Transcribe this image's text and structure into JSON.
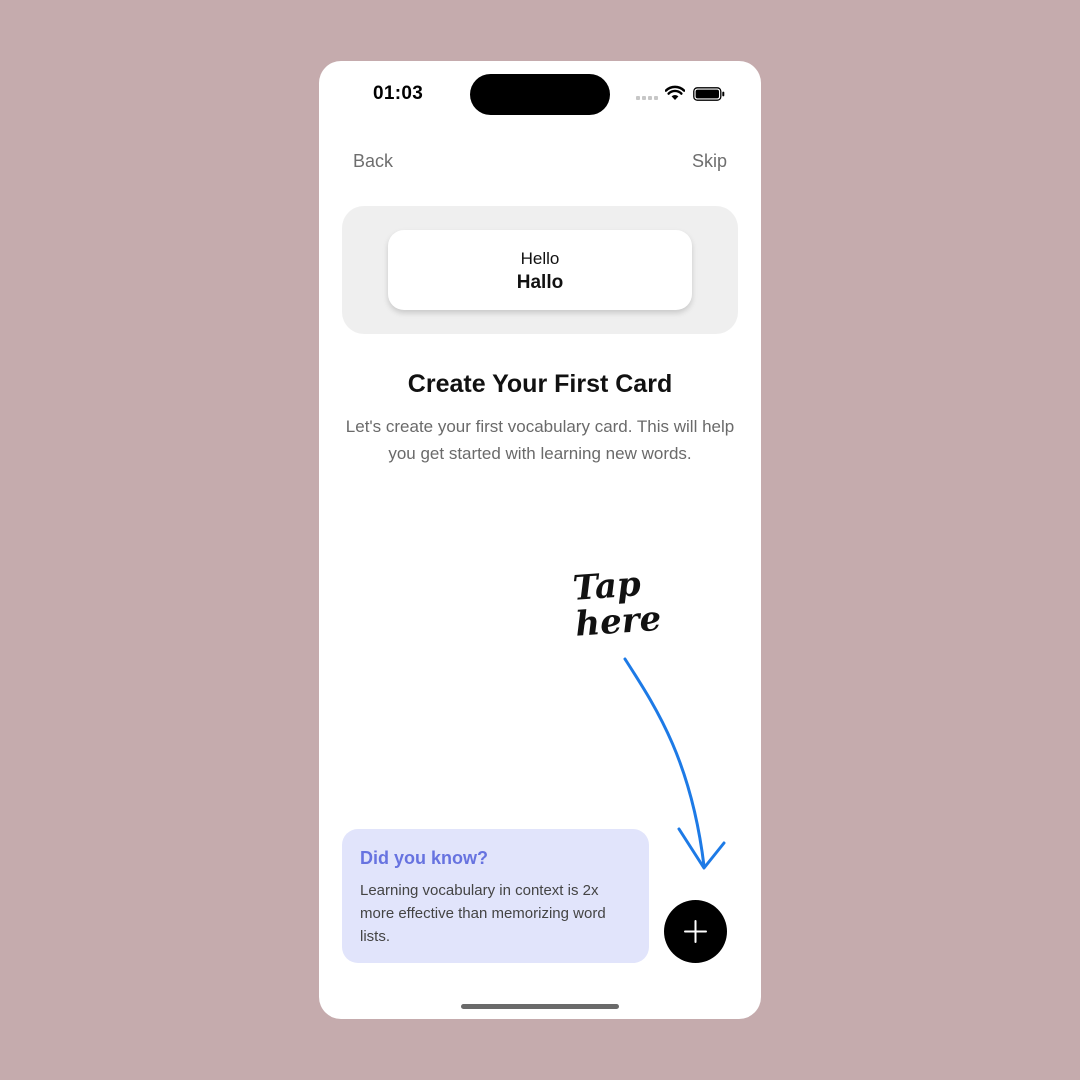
{
  "status_bar": {
    "time": "01:03"
  },
  "nav": {
    "back_label": "Back",
    "skip_label": "Skip"
  },
  "preview_card": {
    "front": "Hello",
    "back": "Hallo"
  },
  "onboarding": {
    "title": "Create Your First Card",
    "subtitle": "Let's create your first vocabulary card. This will help you get started with learning new words."
  },
  "annotation": {
    "hint_line1": "Tap",
    "hint_line2": "here",
    "arrow_color": "#1d7ae6"
  },
  "tip": {
    "title": "Did you know?",
    "body": "Learning vocabulary in context is 2x more effective than memorizing word lists."
  },
  "fab": {
    "icon": "plus-icon"
  },
  "colors": {
    "background": "#c5abad",
    "tip_background": "#e1e4fb",
    "tip_title": "#6773e0",
    "fab": "#000000"
  }
}
